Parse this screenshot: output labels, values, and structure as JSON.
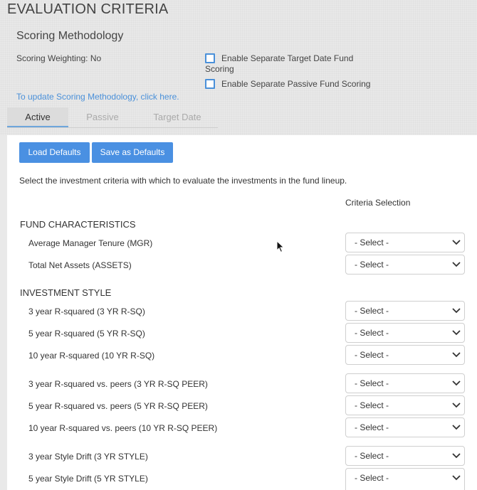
{
  "page": {
    "title": "EVALUATION CRITERIA"
  },
  "methodology": {
    "title": "Scoring Methodology",
    "weighting": "Scoring Weighting: No",
    "checkbox_target_line1": "Enable Separate Target Date Fund",
    "checkbox_target_line2": "Scoring",
    "checkbox_passive": "Enable Separate Passive Fund Scoring",
    "update_link": "To update Scoring Methodology, click here."
  },
  "tabs": [
    {
      "label": "Active",
      "active": true
    },
    {
      "label": "Passive",
      "active": false
    },
    {
      "label": "Target Date",
      "active": false
    }
  ],
  "toolbar": {
    "load_label": "Load Defaults",
    "save_label": "Save as Defaults"
  },
  "instructions": "Select the investment criteria with which to evaluate the investments in the fund lineup.",
  "criteria_header": "Criteria Selection",
  "groups": [
    {
      "title": "FUND CHARACTERISTICS",
      "rows": [
        {
          "label": "Average Manager Tenure (MGR)",
          "value": "- Select -"
        },
        {
          "label": "Total Net Assets (ASSETS)",
          "value": "- Select -"
        }
      ]
    },
    {
      "title": "INVESTMENT STYLE",
      "rows": [
        {
          "label": "3 year R-squared (3 YR R-SQ)",
          "value": "- Select -"
        },
        {
          "label": "5 year R-squared (5 YR R-SQ)",
          "value": "- Select -"
        },
        {
          "label": "10 year R-squared (10 YR R-SQ)",
          "value": "- Select -"
        },
        {
          "label": "3 year R-squared vs. peers (3 YR R-SQ PEER)",
          "value": "- Select -"
        },
        {
          "label": "5 year R-squared vs. peers (5 YR R-SQ PEER)",
          "value": "- Select -"
        },
        {
          "label": "10 year R-squared vs. peers (10 YR R-SQ PEER)",
          "value": "- Select -"
        },
        {
          "label": "3 year Style Drift (3 YR STYLE)",
          "value": "- Select -"
        },
        {
          "label": "5 year Style Drift (5 YR STYLE)",
          "value": "- Select -"
        }
      ]
    }
  ],
  "colors": {
    "accent": "#4a90e2",
    "link": "#4a90d9",
    "tab_underline": "#6ea6dc"
  }
}
